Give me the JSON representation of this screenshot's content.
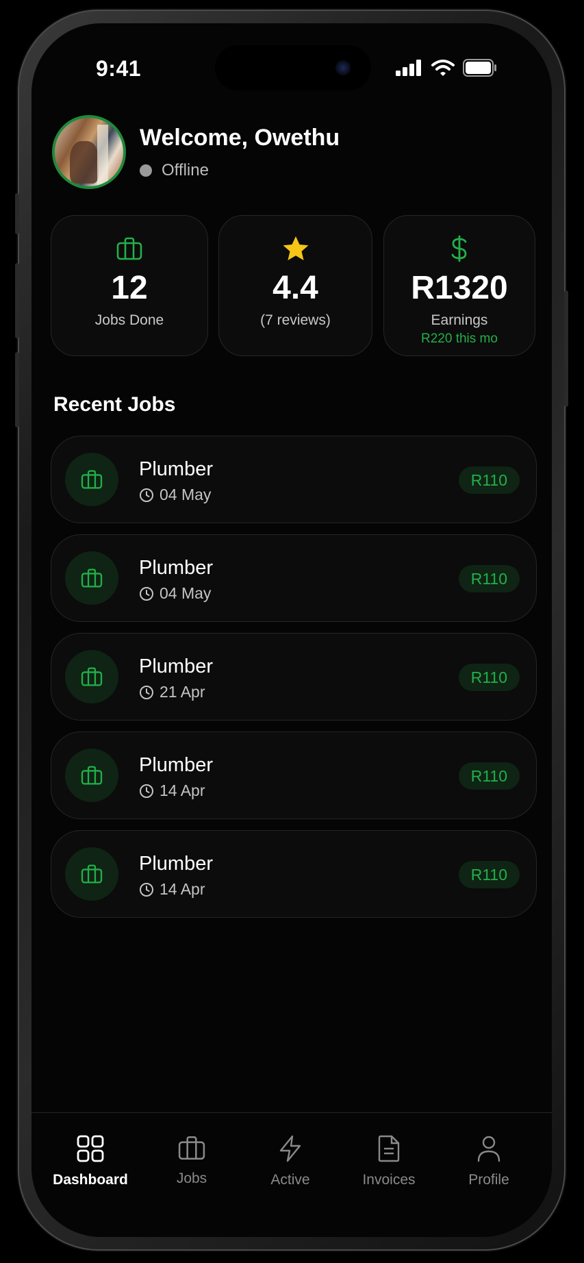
{
  "status_bar": {
    "time": "9:41"
  },
  "header": {
    "welcome": "Welcome, Owethu",
    "status": "Offline"
  },
  "stats": [
    {
      "icon": "briefcase-icon",
      "value": "12",
      "label": "Jobs Done"
    },
    {
      "icon": "star-icon",
      "value": "4.4",
      "label": "(7 reviews)"
    },
    {
      "icon": "dollar-icon",
      "value": "R1320",
      "label": "Earnings",
      "sub": "R220 this mo"
    }
  ],
  "recent_jobs": {
    "title": "Recent Jobs",
    "items": [
      {
        "title": "Plumber",
        "date": "04 May",
        "price": "R110"
      },
      {
        "title": "Plumber",
        "date": "04 May",
        "price": "R110"
      },
      {
        "title": "Plumber",
        "date": "21 Apr",
        "price": "R110"
      },
      {
        "title": "Plumber",
        "date": "14 Apr",
        "price": "R110"
      },
      {
        "title": "Plumber",
        "date": "14 Apr",
        "price": "R110"
      }
    ]
  },
  "tabs": [
    {
      "label": "Dashboard",
      "icon": "grid-icon",
      "active": true
    },
    {
      "label": "Jobs",
      "icon": "briefcase-icon",
      "active": false
    },
    {
      "label": "Active",
      "icon": "lightning-icon",
      "active": false
    },
    {
      "label": "Invoices",
      "icon": "document-icon",
      "active": false
    },
    {
      "label": "Profile",
      "icon": "user-icon",
      "active": false
    }
  ],
  "colors": {
    "accent": "#22b04a",
    "star": "#f5c518",
    "background": "#050505",
    "card": "#0c0c0c"
  }
}
